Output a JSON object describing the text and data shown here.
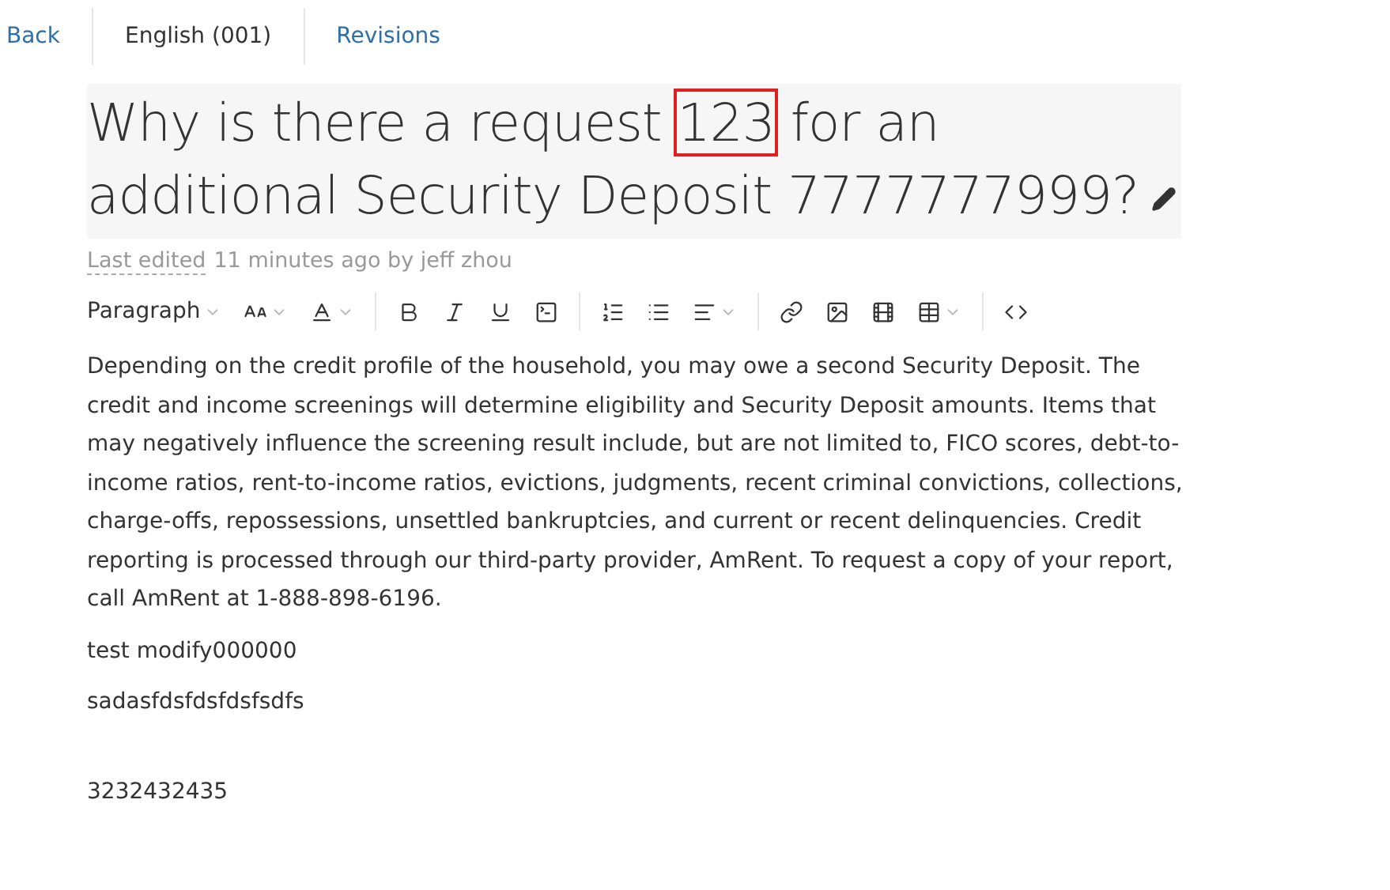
{
  "nav": [
    {
      "label": "Back",
      "kind": "link"
    },
    {
      "label": "English (001)",
      "kind": "plain"
    },
    {
      "label": "Revisions",
      "kind": "link"
    }
  ],
  "title": {
    "segments": [
      {
        "text": "Why is there a request ",
        "highlighted": false
      },
      {
        "text": "123",
        "highlighted": true
      },
      {
        "text": " for an additional Security Deposit 7777777999?",
        "highlighted": false
      }
    ]
  },
  "meta": {
    "label": "Last edited",
    "detail": "11 minutes ago by jeff zhou"
  },
  "toolbar": {
    "block_format": "Paragraph"
  },
  "paragraphs": [
    {
      "kind": "text",
      "text": "Depending on the credit profile of the household, you may owe a second Security Deposit. The credit and income screenings will determine eligibility and Security Deposit amounts. Items that may negatively influence the screening result include, but are not limited to, FICO scores, debt-to-income ratios, rent-to-income ratios, evictions, judgments, recent criminal convictions, collections, charge-offs, repossessions, unsettled bankruptcies, and current or recent delinquencies. Credit reporting is processed through our third-party provider, AmRent. To request a copy of your report, call AmRent at 1-888-898-6196."
    },
    {
      "kind": "text",
      "text": "test modify000000"
    },
    {
      "kind": "text",
      "text": "sadasfdsfdsfdsfsdfs"
    },
    {
      "kind": "blank"
    },
    {
      "kind": "text",
      "text": "3232432435"
    }
  ]
}
